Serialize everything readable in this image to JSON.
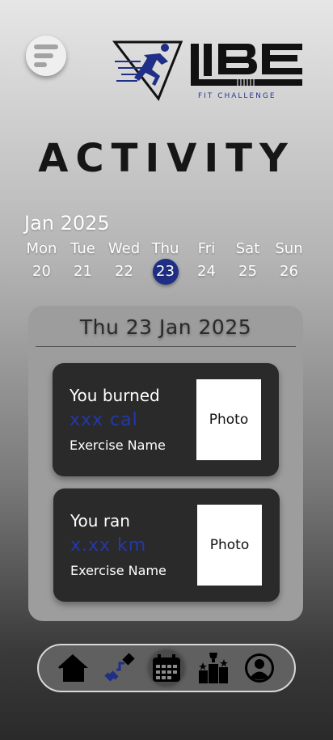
{
  "brand": {
    "name": "VIBE",
    "tagline": "FIT CHALLENGE",
    "accent_color": "#1f2e86"
  },
  "header": {
    "menu_icon": "menu-icon"
  },
  "page": {
    "title": "ACTIVITY"
  },
  "calendar": {
    "month_label": "Jan 2025",
    "days": [
      {
        "name": "Mon",
        "num": "20"
      },
      {
        "name": "Tue",
        "num": "21"
      },
      {
        "name": "Wed",
        "num": "22"
      },
      {
        "name": "Thu",
        "num": "23"
      },
      {
        "name": "Fri",
        "num": "24"
      },
      {
        "name": "Sat",
        "num": "25"
      },
      {
        "name": "Sun",
        "num": "26"
      }
    ],
    "selected_day": "23"
  },
  "panel": {
    "date_heading": "Thu 23 Jan 2025",
    "cards": [
      {
        "label": "You burned",
        "value": "xxx cal",
        "exercise": "Exercise Name",
        "photo": "Photo"
      },
      {
        "label": "You ran",
        "value": "x.xx km",
        "exercise": "Exercise Name",
        "photo": "Photo"
      }
    ]
  },
  "navbar": {
    "items": [
      {
        "icon": "home-icon"
      },
      {
        "icon": "dumbbell-icon"
      },
      {
        "icon": "calendar-icon",
        "active": true
      },
      {
        "icon": "leaderboard-icon"
      },
      {
        "icon": "profile-icon"
      }
    ]
  }
}
